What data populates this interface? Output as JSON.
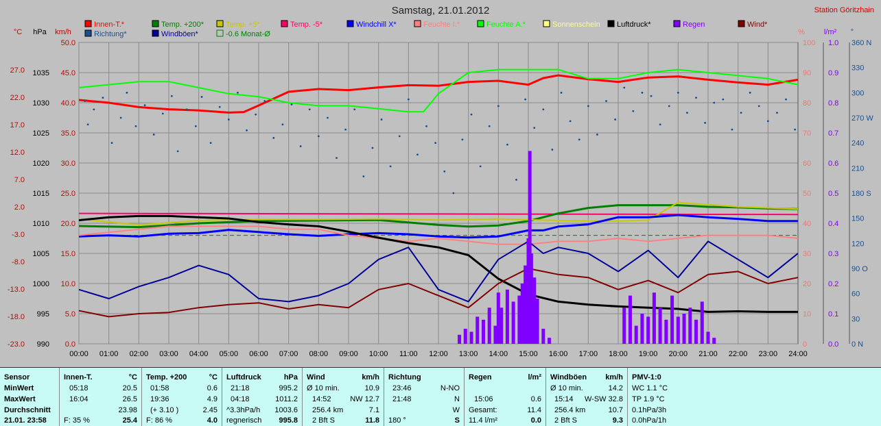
{
  "chart_data": {
    "type": "line",
    "title": "Samstag, 21.01.2012",
    "station": "Station Göritzhain",
    "x_ticks": [
      "00:00",
      "01:00",
      "02:00",
      "03:00",
      "04:00",
      "05:00",
      "06:00",
      "07:00",
      "08:00",
      "09:00",
      "10:00",
      "11:00",
      "12:00",
      "13:00",
      "14:00",
      "15:00",
      "16:00",
      "17:00",
      "18:00",
      "19:00",
      "20:00",
      "21:00",
      "22:00",
      "23:00",
      "24:00"
    ],
    "axes": {
      "temp_c": {
        "label": "°C",
        "color": "#cc0000",
        "ticks": [
          "27.0",
          "22.0",
          "17.0",
          "12.0",
          "7.0",
          "2.0",
          "-3.0",
          "-8.0",
          "-13.0",
          "-18.0",
          "-23.0"
        ]
      },
      "pressure_hpa": {
        "label": "hPa",
        "color": "#000000",
        "ticks": [
          "1035",
          "1030",
          "1025",
          "1020",
          "1015",
          "1010",
          "1005",
          "1000",
          "995",
          "990"
        ]
      },
      "wind_kmh": {
        "label": "km/h",
        "color": "#cc0000",
        "ticks": [
          "50.0",
          "45.0",
          "40.0",
          "35.0",
          "30.0",
          "25.0",
          "20.0",
          "15.0",
          "10.0",
          "5.0",
          "0.0"
        ]
      },
      "humidity_pct": {
        "label": "%",
        "color": "#ff7070",
        "ticks": [
          "100",
          "90",
          "80",
          "70",
          "60",
          "50",
          "40",
          "30",
          "20",
          "10",
          "0"
        ]
      },
      "rain_lm2": {
        "label": "l/m²",
        "color": "#8000ff",
        "ticks": [
          "1.0",
          "0.9",
          "0.8",
          "0.7",
          "0.6",
          "0.5",
          "0.4",
          "0.3",
          "0.2",
          "0.1",
          "0.0"
        ]
      },
      "direction_deg": {
        "label": "°",
        "color": "#1a4f8f",
        "ticks": [
          "360 N",
          "330",
          "300",
          "270 W",
          "240",
          "210",
          "180 S",
          "150",
          "120",
          "90 O",
          "60",
          "30",
          "0 N"
        ]
      }
    },
    "legend": [
      {
        "name": "Innen-T.*",
        "color": "#ff0000"
      },
      {
        "name": "Temp. +200*",
        "color": "#008000"
      },
      {
        "name": "Temp. +5*",
        "color": "#c8c800"
      },
      {
        "name": "Temp. -5*",
        "color": "#ff0066"
      },
      {
        "name": "Windchill X*",
        "color": "#0000ff"
      },
      {
        "name": "Feuchte I.*",
        "color": "#ff8080"
      },
      {
        "name": "Feuchte A.*",
        "color": "#00ff00"
      },
      {
        "name": "Sonnenschein",
        "color": "#ffff80"
      },
      {
        "name": "Luftdruck*",
        "color": "#000000"
      },
      {
        "name": "Regen",
        "color": "#8000ff"
      },
      {
        "name": "Wind*",
        "color": "#800000"
      },
      {
        "name": "Richtung*",
        "color": "#1a4f8f"
      },
      {
        "name": "Windböen*",
        "color": "#000099"
      },
      {
        "name": "-0.6 Monat-Ø",
        "color": "#008000"
      }
    ],
    "series": [
      {
        "name": "Innen-T.*",
        "axis": "temp_c",
        "x": [
          0,
          1,
          2,
          3,
          4,
          5,
          5.5,
          6,
          7,
          8,
          9,
          10,
          11,
          12,
          13,
          14,
          15,
          15.5,
          16,
          17,
          18,
          19,
          20,
          21,
          22,
          23,
          24
        ],
        "values": [
          21.5,
          21,
          20.2,
          19.8,
          19.6,
          19.2,
          19.3,
          20.5,
          23,
          23.5,
          23.3,
          23.8,
          24.2,
          24.1,
          24.8,
          25,
          24.3,
          25.5,
          26,
          25.3,
          24.8,
          25.6,
          25.8,
          25.2,
          24.7,
          24.3,
          25.2
        ]
      },
      {
        "name": "Feuchte A.*",
        "axis": "humidity_pct",
        "x": [
          0,
          1,
          2,
          3,
          4,
          5,
          6,
          7,
          8,
          9,
          10,
          11,
          11.5,
          12,
          13,
          14,
          15,
          16,
          17,
          18,
          19,
          20,
          21,
          22,
          23,
          24
        ],
        "values": [
          85,
          86,
          87,
          87,
          85,
          83,
          82,
          80,
          79,
          79,
          78,
          77,
          77,
          83,
          90,
          91,
          91,
          91,
          88,
          88,
          90,
          91,
          90,
          89,
          88,
          86
        ]
      },
      {
        "name": "Temp. -5*",
        "axis": "temp_c",
        "x": [
          0,
          24
        ],
        "values": [
          0.8,
          0.6
        ]
      },
      {
        "name": "Temp. +200*",
        "axis": "temp_c",
        "x": [
          0,
          2,
          4,
          6,
          8,
          10,
          12,
          13,
          14,
          15,
          16,
          17,
          18,
          19,
          20,
          21,
          22,
          23,
          24
        ],
        "values": [
          -1.5,
          -1.7,
          -1,
          -0.6,
          -0.5,
          -0.4,
          -1.3,
          -1.6,
          -1.4,
          -0.6,
          0.8,
          1.8,
          2.3,
          2.3,
          2.3,
          2.0,
          1.9,
          1.7,
          1.6
        ]
      },
      {
        "name": "Temp. +5*",
        "axis": "temp_c",
        "x": [
          0,
          2,
          4,
          6,
          8,
          10,
          12,
          14,
          16,
          18,
          19,
          20,
          22,
          24
        ],
        "values": [
          -0.2,
          -1.3,
          -0.5,
          -0.3,
          -0.3,
          -0.2,
          -0.4,
          -0.2,
          -0.5,
          -0.6,
          -0.4,
          2.8,
          2.0,
          1.6
        ]
      },
      {
        "name": "Windchill X*",
        "axis": "temp_c",
        "x": [
          0,
          1,
          2,
          3,
          4,
          5,
          6,
          7,
          8,
          9,
          10,
          11,
          12,
          13,
          14,
          15,
          15.5,
          16,
          17,
          18,
          19,
          20,
          21,
          22,
          23,
          24
        ],
        "values": [
          -3.4,
          -3.2,
          -3.4,
          -2.9,
          -2.8,
          -2.2,
          -2.6,
          -3.0,
          -3.3,
          -3.0,
          -2.8,
          -3.0,
          -3.4,
          -3.6,
          -3.4,
          -2.3,
          -2.3,
          -1.6,
          -1.2,
          0.1,
          0.1,
          0.5,
          0.1,
          -0.2,
          -0.6,
          -0.6
        ]
      },
      {
        "name": "Feuchte I.*",
        "axis": "humidity_pct",
        "x": [
          0,
          1,
          2,
          3,
          4,
          5,
          6,
          7,
          8,
          9,
          10,
          11,
          12,
          13,
          14,
          15,
          16,
          17,
          18,
          19,
          20,
          21,
          22,
          23,
          24
        ],
        "values": [
          36,
          37,
          38,
          39,
          39,
          39,
          39,
          38,
          38,
          36,
          35,
          34,
          35,
          34,
          33,
          33,
          34,
          34,
          35,
          34,
          35,
          36,
          36,
          36,
          35
        ]
      },
      {
        "name": "Luftdruck*",
        "axis": "pressure_hpa",
        "x": [
          0,
          1,
          2,
          3,
          4,
          5,
          6,
          7,
          8,
          9,
          10,
          11,
          12,
          13,
          14,
          15,
          16,
          17,
          18,
          19,
          20,
          21,
          22,
          23,
          24
        ],
        "values": [
          1010.5,
          1011,
          1011.2,
          1011.2,
          1011,
          1010.8,
          1010.2,
          1009.8,
          1009.5,
          1008.6,
          1007.6,
          1006.7,
          1006,
          1004.7,
          1000.8,
          998.2,
          997,
          996.5,
          996.2,
          996,
          995.8,
          995.3,
          995.4,
          995.3,
          995.3
        ]
      },
      {
        "name": "Wind*",
        "axis": "wind_kmh",
        "x": [
          0,
          1,
          2,
          3,
          4,
          5,
          6,
          7,
          8,
          9,
          10,
          11,
          12,
          13,
          14,
          15,
          15.5,
          16,
          17,
          18,
          19,
          20,
          21,
          22,
          23,
          24
        ],
        "values": [
          5.5,
          4.5,
          5.0,
          5.2,
          6.0,
          6.5,
          6.8,
          5.8,
          6.5,
          6.0,
          9.0,
          10.0,
          8.0,
          6.0,
          10.0,
          12.5,
          12.0,
          11.5,
          11.0,
          9.0,
          10.5,
          8.5,
          11.5,
          12.0,
          10.0,
          11.0
        ]
      },
      {
        "name": "Windböen*",
        "axis": "wind_kmh",
        "x": [
          0,
          1,
          2,
          3,
          4,
          5,
          6,
          7,
          8,
          9,
          10,
          11,
          12,
          13,
          14,
          15,
          15.5,
          16,
          17,
          18,
          19,
          20,
          21,
          22,
          23,
          24
        ],
        "values": [
          9.0,
          7.5,
          9.5,
          11.0,
          13.0,
          11.5,
          7.5,
          7.0,
          8.0,
          10.0,
          14.0,
          16.0,
          9.0,
          7.0,
          14.0,
          17.0,
          15.0,
          16.0,
          15.0,
          12.0,
          15.5,
          11.0,
          17.0,
          14.0,
          11.0,
          15.0
        ]
      },
      {
        "name": "Regen",
        "axis": "rain_lm2",
        "type": "bar",
        "x": [
          12.7,
          12.9,
          13.1,
          13.3,
          13.5,
          13.7,
          13.9,
          14.0,
          14.1,
          14.3,
          14.5,
          14.7,
          14.8,
          14.9,
          15.0,
          15.05,
          15.1,
          15.2,
          15.3,
          15.5,
          15.7,
          18.2,
          18.4,
          18.6,
          18.8,
          19.0,
          19.2,
          19.4,
          19.6,
          19.8,
          20.0,
          20.2,
          20.4,
          20.6,
          20.8,
          21.0,
          21.2
        ],
        "values": [
          0.03,
          0.05,
          0.04,
          0.09,
          0.08,
          0.12,
          0.06,
          0.17,
          0.12,
          0.18,
          0.14,
          0.16,
          0.2,
          0.26,
          0.35,
          0.64,
          0.3,
          0.22,
          0.15,
          0.05,
          0.02,
          0.12,
          0.16,
          0.06,
          0.1,
          0.09,
          0.17,
          0.12,
          0.08,
          0.16,
          0.09,
          0.1,
          0.12,
          0.08,
          0.14,
          0.04,
          0.02
        ]
      },
      {
        "name": "Richtung*",
        "axis": "direction_deg",
        "type": "scatter",
        "x": [
          0.2,
          0.3,
          0.5,
          0.8,
          1.1,
          1.4,
          1.6,
          1.9,
          2.2,
          2.5,
          2.8,
          3.1,
          3.3,
          3.6,
          3.9,
          4.1,
          4.4,
          4.7,
          5.0,
          5.3,
          5.6,
          5.9,
          6.2,
          6.5,
          6.8,
          7.1,
          7.4,
          7.7,
          8.0,
          8.3,
          8.6,
          8.9,
          9.2,
          9.5,
          9.8,
          10.1,
          10.4,
          10.7,
          11.0,
          11.3,
          11.6,
          11.9,
          12.2,
          12.5,
          12.8,
          13.1,
          13.4,
          13.7,
          14.0,
          14.3,
          14.6,
          14.9,
          15.2,
          15.5,
          15.8,
          16.1,
          16.4,
          16.7,
          17.0,
          17.3,
          17.6,
          17.9,
          18.2,
          18.5,
          18.8,
          19.1,
          19.4,
          19.7,
          20.0,
          20.3,
          20.6,
          20.9,
          21.2,
          21.5,
          21.8,
          22.1,
          22.4,
          22.7,
          23.0,
          23.3,
          23.6,
          23.9
        ],
        "values": [
          290,
          262,
          280,
          294,
          240,
          270,
          300,
          260,
          285,
          250,
          275,
          296,
          230,
          280,
          260,
          295,
          240,
          283,
          268,
          300,
          255,
          274,
          290,
          246,
          262,
          286,
          236,
          280,
          248,
          270,
          222,
          256,
          280,
          200,
          234,
          268,
          212,
          248,
          292,
          226,
          260,
          240,
          206,
          180,
          244,
          274,
          212,
          260,
          284,
          238,
          196,
          292,
          258,
          280,
          232,
          300,
          266,
          244,
          284,
          250,
          290,
          268,
          306,
          278,
          300,
          296,
          262,
          284,
          300,
          276,
          294,
          264,
          288,
          292,
          256,
          276,
          300,
          284,
          266,
          276,
          292,
          256
        ]
      }
    ],
    "ranges": {
      "temp_c": [
        -23,
        32
      ],
      "pressure_hpa": [
        990,
        1040
      ],
      "wind_kmh": [
        0,
        50
      ],
      "humidity_pct": [
        0,
        100
      ],
      "rain_lm2": [
        0,
        1
      ],
      "direction_deg": [
        0,
        360
      ]
    }
  },
  "stats": {
    "sensor": {
      "head": "Sensor",
      "min": "MinWert",
      "max": "MaxWert",
      "avg": "Durchschnitt",
      "now": "21.01. 23:58"
    },
    "innen": {
      "head": "Innen-T.",
      "unit": "°C",
      "min_t": "05:18",
      "min_v": "20.5",
      "max_t": "16:04",
      "max_v": "26.5",
      "avg": "23.98",
      "hum": "F: 35 %",
      "now": "25.4"
    },
    "temp": {
      "head": "Temp. +200",
      "unit": "°C",
      "min_t": "01:58",
      "min_v": "0.6",
      "max_t": "19:36",
      "max_v": "4.9",
      "note": "(+ 3.10 )",
      "avg": "2.45",
      "hum": "F: 86 %",
      "now": "4.0"
    },
    "druck": {
      "head": "Luftdruck",
      "unit": "hPa",
      "min_t": "21:18",
      "min_v": "995.2",
      "max_t": "04:18",
      "max_v": "1011.2",
      "trend": "^3.3hPa/h",
      "avg": "1003.6",
      "fc": "regnerisch",
      "now": "995.8"
    },
    "wind": {
      "head": "Wind",
      "unit": "km/h",
      "r1a": "Ø 10 min.",
      "r1b": "10.9",
      "r2a": "14:52",
      "r2b": "NW 12.7",
      "r3a": "256.4 km",
      "r3b": "7.1",
      "r4a": "2 Bft S",
      "now": "11.8"
    },
    "richtung": {
      "head": "Richtung",
      "r1a": "23:46",
      "r1b": "N-NO",
      "r2a": "21:48",
      "r2b": "N",
      "r3b": "W",
      "r4a": "180 °",
      "now": "S"
    },
    "regen": {
      "head": "Regen",
      "unit": "l/m²",
      "r2a": "15:06",
      "r2b": "0.6",
      "r3a": "Gesamt:",
      "r3b": "11.4",
      "r4a": "11.4 l/m²",
      "now": "0.0"
    },
    "boeen": {
      "head": "Windböen",
      "unit": "km/h",
      "r1a": "Ø 10 min.",
      "r1b": "14.2",
      "r2a": "15:14",
      "r2b": "W-SW 32.8",
      "r3a": "256.4 km",
      "r3b": "10.7",
      "r4a": "2 Bft S",
      "now": "9.3"
    },
    "pmv": {
      "head": "PMV-1:0",
      "r1": "WC 1.1 °C",
      "r2": "TP 1.9 °C",
      "r3": "0.1hPa/3h",
      "r4": "0.0hPa/1h"
    }
  }
}
